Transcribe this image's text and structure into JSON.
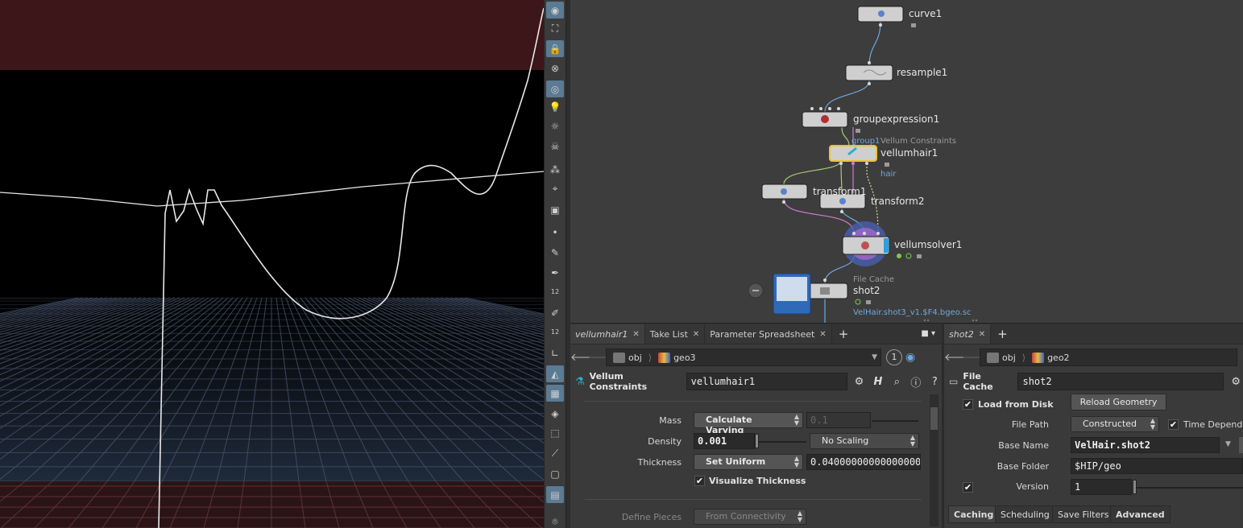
{
  "network": {
    "nodes": [
      {
        "name": "curve1"
      },
      {
        "name": "resample1"
      },
      {
        "name": "groupexpression1"
      },
      {
        "name": "vellumhair1",
        "type_label": "Vellum Constraints",
        "group_label": "group1",
        "output_label": "hair"
      },
      {
        "name": "transform1"
      },
      {
        "name": "transform2"
      },
      {
        "name": "vellumsolver1"
      },
      {
        "name": "shot2",
        "type_label": "File Cache",
        "file_label": "VelHair.shot3_v1.$F4.bgeo.sc"
      }
    ]
  },
  "toolbar": {
    "badges": [
      "12",
      "12"
    ]
  },
  "left_pane": {
    "tabs": [
      {
        "label": "vellumhair1"
      },
      {
        "label": "Take List"
      },
      {
        "label": "Parameter Spreadsheet"
      }
    ],
    "path": [
      "obj",
      "geo3"
    ],
    "path_badge": "1",
    "node_type": "Vellum Constraints",
    "node_name": "vellumhair1",
    "params": {
      "mass_label": "Mass",
      "mass_mode": "Calculate Varying",
      "mass_value": "0.1",
      "density_label": "Density",
      "density_value": "0.001",
      "density_scaling": "No Scaling",
      "thickness_label": "Thickness",
      "thickness_mode": "Set Uniform",
      "thickness_value": "0.0400000000000000001",
      "visualize_label": "Visualize Thickness",
      "define_pieces_label": "Define Pieces",
      "define_pieces_value": "From Connectivity"
    }
  },
  "right_pane": {
    "tabs": [
      {
        "label": "shot2"
      }
    ],
    "path": [
      "obj",
      "geo2"
    ],
    "node_type": "File Cache",
    "node_name": "shot2",
    "params": {
      "load_from_disk_label": "Load from Disk",
      "reload_button": "Reload Geometry",
      "file_path_label": "File Path",
      "file_path_mode": "Constructed",
      "time_dependent_label": "Time Dependen",
      "base_name_label": "Base Name",
      "base_name_value": "VelHair.shot2",
      "base_folder_label": "Base Folder",
      "base_folder_value": "$HIP/geo",
      "version_label": "Version",
      "version_value": "1"
    },
    "subtabs": [
      {
        "label": "Caching"
      },
      {
        "label": "Scheduling"
      },
      {
        "label": "Save Filters"
      },
      {
        "label": "Advanced"
      }
    ]
  },
  "colors": {
    "viewport_red": "#3d1619",
    "viewport_floor": "#2b1416",
    "selected_node": "#e8c42c",
    "wire_green": "#a8c878",
    "wire_pink": "#d07ad0",
    "wire_blue": "#6ea8e0"
  }
}
